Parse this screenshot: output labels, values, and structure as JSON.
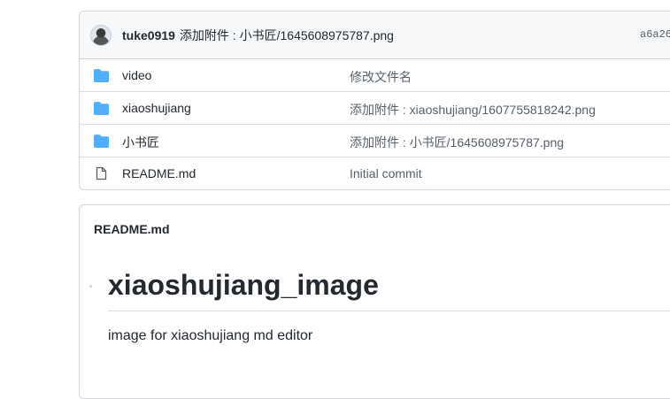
{
  "latest_commit": {
    "author": "tuke0919",
    "message": "添加附件 : 小书匠/1645608975787.png",
    "hash": "a6a26"
  },
  "files": [
    {
      "name": "video",
      "type": "directory",
      "icon": "folder-icon",
      "commit_message": "修改文件名"
    },
    {
      "name": "xiaoshujiang",
      "type": "directory",
      "icon": "folder-icon",
      "commit_message": "添加附件 : xiaoshujiang/1607755818242.png"
    },
    {
      "name": "小书匠",
      "type": "directory",
      "icon": "folder-icon",
      "commit_message": "添加附件 : 小书匠/1645608975787.png"
    },
    {
      "name": "README.md",
      "type": "file",
      "icon": "file-icon",
      "commit_message": "Initial commit"
    }
  ],
  "readme": {
    "filename": "README.md",
    "heading": "xiaoshujiang_image",
    "paragraph": "image for xiaoshujiang md editor"
  },
  "colors": {
    "folder": "#54aeff",
    "border": "#d0d7de",
    "header_bg": "#f6f8fa",
    "text": "#24292f",
    "muted": "#57606a"
  }
}
